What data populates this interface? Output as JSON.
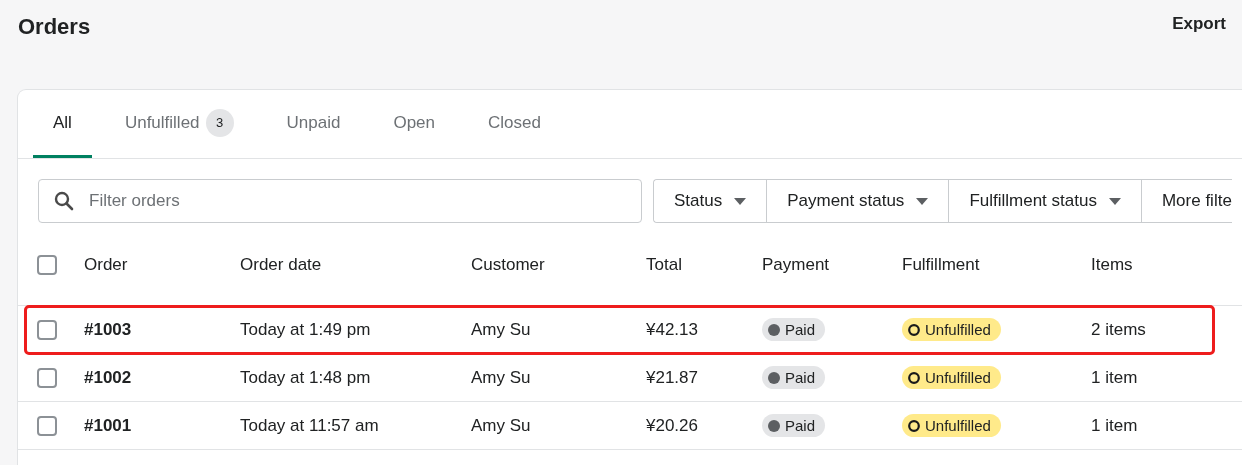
{
  "page": {
    "title": "Orders",
    "export_label": "Export"
  },
  "tabs": [
    {
      "label": "All",
      "selected": true
    },
    {
      "label": "Unfulfilled",
      "count": "3",
      "selected": false
    },
    {
      "label": "Unpaid",
      "selected": false
    },
    {
      "label": "Open",
      "selected": false
    },
    {
      "label": "Closed",
      "selected": false
    }
  ],
  "search": {
    "placeholder": "Filter orders"
  },
  "filters": [
    "Status",
    "Payment status",
    "Fulfillment status",
    "More filte"
  ],
  "table": {
    "select_all_checked": false,
    "columns": [
      "Order",
      "Order date",
      "Customer",
      "Total",
      "Payment",
      "Fulfillment",
      "Items"
    ],
    "rows": [
      {
        "checked": false,
        "highlighted": true,
        "order": "#1003",
        "date": "Today at 1:49 pm",
        "customer": "Amy Su",
        "total": "¥42.13",
        "payment": "Paid",
        "fulfillment": "Unfulfilled",
        "items": "2 items"
      },
      {
        "checked": false,
        "highlighted": false,
        "order": "#1002",
        "date": "Today at 1:48 pm",
        "customer": "Amy Su",
        "total": "¥21.87",
        "payment": "Paid",
        "fulfillment": "Unfulfilled",
        "items": "1 item"
      },
      {
        "checked": false,
        "highlighted": false,
        "order": "#1001",
        "date": "Today at 11:57 am",
        "customer": "Amy Su",
        "total": "¥20.26",
        "payment": "Paid",
        "fulfillment": "Unfulfilled",
        "items": "1 item"
      }
    ]
  }
}
